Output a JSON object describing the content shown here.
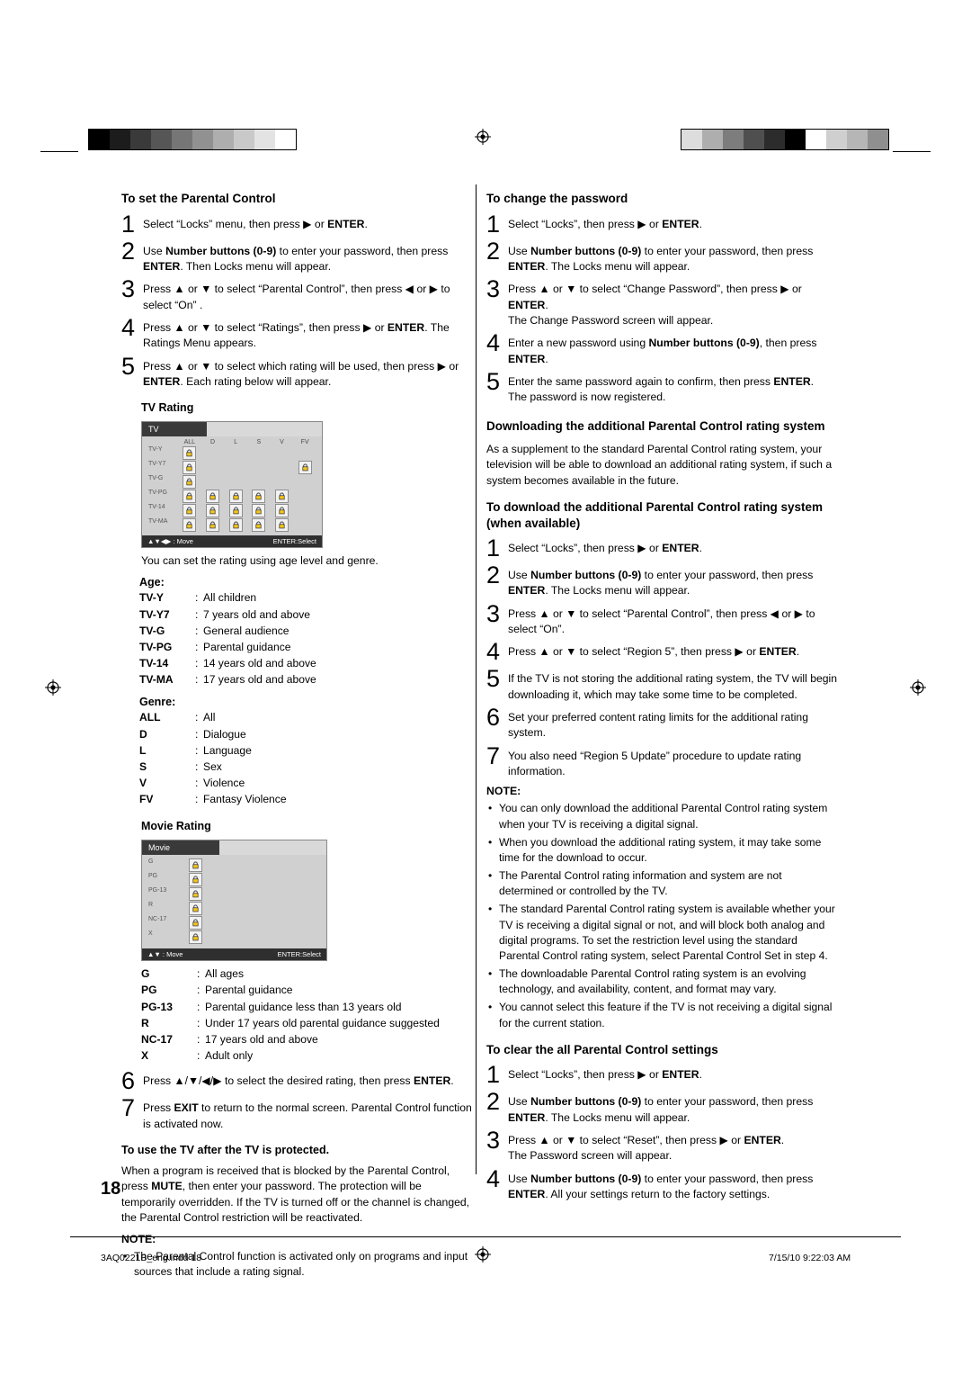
{
  "page": {
    "number": "18",
    "footer_left": "3AQ0221B_eng.indd   18",
    "footer_right": "7/15/10   9:22:03 AM"
  },
  "left": {
    "title": "To set the Parental Control",
    "steps": [
      {
        "n": "1",
        "html": "Select “Locks” menu, then press ▶ or <b>ENTER</b>."
      },
      {
        "n": "2",
        "html": "Use <b>Number buttons (0-9)</b> to enter your password, then press <b>ENTER</b>. Then Locks menu will appear."
      },
      {
        "n": "3",
        "html": "Press ▲ or ▼ to select “Parental Control”, then press ◀ or ▶ to select “On” ."
      },
      {
        "n": "4",
        "html": "Press ▲ or ▼ to select “Ratings”, then press ▶ or <b>ENTER</b>. The Ratings Menu appears."
      },
      {
        "n": "5",
        "html": "Press ▲ or ▼ to select which rating will be used, then press ▶ or <b>ENTER</b>. Each rating below will appear."
      }
    ],
    "tv_rating_label": "TV Rating",
    "tv_osd": {
      "tab": "TV",
      "columns": [
        "ALL",
        "D",
        "L",
        "S",
        "V",
        "FV"
      ],
      "rows": [
        "TV-Y",
        "TV-Y7",
        "TV-G",
        "TV-PG",
        "TV-14",
        "TV-MA"
      ],
      "locks": [
        [
          1,
          0,
          0,
          0,
          0,
          0
        ],
        [
          1,
          0,
          0,
          0,
          0,
          1
        ],
        [
          1,
          0,
          0,
          0,
          0,
          0
        ],
        [
          1,
          1,
          1,
          1,
          1,
          0
        ],
        [
          1,
          1,
          1,
          1,
          1,
          0
        ],
        [
          1,
          1,
          1,
          1,
          1,
          0
        ]
      ],
      "footer_left": "▲▼◀▶ : Move",
      "footer_right": "ENTER:Select"
    },
    "note_under_tv": "You can set the rating using age level and genre.",
    "age_label": "Age:",
    "age_items": [
      {
        "k": "TV-Y",
        "v": "All children"
      },
      {
        "k": "TV-Y7",
        "v": "7 years old and above"
      },
      {
        "k": "TV-G",
        "v": "General audience"
      },
      {
        "k": "TV-PG",
        "v": "Parental guidance"
      },
      {
        "k": "TV-14",
        "v": "14 years old and above"
      },
      {
        "k": "TV-MA",
        "v": "17 years old and above"
      }
    ],
    "genre_label": "Genre:",
    "genre_items": [
      {
        "k": "ALL",
        "v": "All"
      },
      {
        "k": "D",
        "v": "Dialogue"
      },
      {
        "k": "L",
        "v": "Language"
      },
      {
        "k": "S",
        "v": "Sex"
      },
      {
        "k": "V",
        "v": "Violence"
      },
      {
        "k": "FV",
        "v": "Fantasy Violence"
      }
    ],
    "movie_rating_label": "Movie Rating",
    "movie_osd": {
      "tab": "Movie",
      "rows": [
        "G",
        "PG",
        "PG-13",
        "R",
        "NC-17",
        "X"
      ],
      "footer_left": "▲▼ : Move",
      "footer_right": "ENTER:Select"
    },
    "movie_items": [
      {
        "k": "G",
        "v": "All ages"
      },
      {
        "k": "PG",
        "v": "Parental guidance"
      },
      {
        "k": "PG-13",
        "v": "Parental guidance less than 13 years old"
      },
      {
        "k": "R",
        "v": "Under 17 years old parental guidance suggested"
      },
      {
        "k": "NC-17",
        "v": "17 years old and above"
      },
      {
        "k": "X",
        "v": "Adult only"
      }
    ],
    "steps2": [
      {
        "n": "6",
        "html": "Press ▲/▼/◀/▶ to select the desired rating, then press <b>ENTER</b>."
      },
      {
        "n": "7",
        "html": "Press <b>EXIT</b> to return to the normal screen. Parental Control function is activated now."
      }
    ],
    "protected_title": "To use the TV after the TV is protected.",
    "protected_body": "When a program is received that is blocked by the Parental Control, press <b>MUTE</b>, then enter your password. The protection will be temporarily overridden. If the TV is turned off or the channel is changed, the Parental Control restriction will be reactivated.",
    "note_label": "NOTE:",
    "notes": [
      "The Parental Control function is activated only on programs and input sources that include a rating signal."
    ]
  },
  "right": {
    "title_password": "To change the password",
    "password_steps": [
      {
        "n": "1",
        "html": "Select “Locks”, then press ▶ or <b>ENTER</b>."
      },
      {
        "n": "2",
        "html": "Use <b>Number buttons (0-9)</b> to enter your password, then press <b>ENTER</b>. The Locks menu will appear."
      },
      {
        "n": "3",
        "html": "Press ▲ or ▼ to select “Change Password”, then press ▶ or <b>ENTER</b>.<br>The Change Password screen will appear."
      },
      {
        "n": "4",
        "html": "Enter a new password using <b>Number buttons (0-9)</b>, then press <b>ENTER</b>."
      },
      {
        "n": "5",
        "html": "Enter the same password again to confirm, then press <b>ENTER</b>.<br>The password is now registered."
      }
    ],
    "title_download": "Downloading the additional Parental Control rating system",
    "download_body": "As a supplement to the standard Parental Control rating system, your television will be able to download an additional rating system, if such a system becomes available in the future.",
    "title_download_steps": "To download the additional Parental Control rating system (when available)",
    "download_steps": [
      {
        "n": "1",
        "html": "Select “Locks”, then press ▶ or <b>ENTER</b>."
      },
      {
        "n": "2",
        "html": "Use <b>Number buttons (0-9)</b> to enter your password, then press <b>ENTER</b>. The Locks menu will appear."
      },
      {
        "n": "3",
        "html": "Press ▲ or ▼ to select “Parental Control”, then press ◀ or ▶ to select “On”."
      },
      {
        "n": "4",
        "html": "Press ▲ or ▼ to select “Region 5”, then press ▶ or <b>ENTER</b>."
      },
      {
        "n": "5",
        "html": "If the TV is not storing the additional rating system, the TV will begin downloading it, which may take some time to be completed."
      },
      {
        "n": "6",
        "html": "Set your preferred content rating limits for the additional rating system."
      },
      {
        "n": "7",
        "html": "You also need “Region 5 Update” procedure to update rating information."
      }
    ],
    "note_label": "NOTE:",
    "notes": [
      "You can only download the additional Parental Control rating system when your TV is receiving a digital signal.",
      "When you download the additional rating system, it may take some time for the download to occur.",
      "The Parental Control rating information and system are not determined or controlled by the TV.",
      "The standard Parental Control rating system is available whether your TV is receiving a digital signal or not, and will block both analog and digital programs. To set the restriction level using the standard Parental Control rating system, select Parental Control Set in step 4.",
      "The downloadable Parental Control rating system is an evolving technology, and availability, content, and format may vary.",
      "You cannot select this feature if the TV is not receiving a digital signal for the current station."
    ],
    "title_clear": "To clear the all Parental Control settings",
    "clear_steps": [
      {
        "n": "1",
        "html": "Select “Locks”, then press ▶ or <b>ENTER</b>."
      },
      {
        "n": "2",
        "html": "Use <b>Number buttons (0-9)</b> to enter your password, then press <b>ENTER</b>. The Locks menu will appear."
      },
      {
        "n": "3",
        "html": "Press ▲ or ▼ to select “Reset”, then press ▶ or <b>ENTER</b>.<br>The Password screen will appear."
      },
      {
        "n": "4",
        "html": "Use <b>Number buttons (0-9)</b> to enter your password, then press <b>ENTER</b>. All your settings return to the factory settings."
      }
    ]
  },
  "marks": {
    "left_bar": [
      "#000000",
      "#1a1a1a",
      "#333333",
      "#4d4d4d",
      "#666666",
      "#808080",
      "#999999",
      "#b3b3b3",
      "#cccccc",
      "#e6e6e6"
    ],
    "right_bar": [
      "#e0e0e0",
      "#b3b3b3",
      "#808080",
      "#4d4d4d",
      "#333333",
      "#000000",
      "#ffffff",
      "#d0d0d0",
      "#b0b0b0",
      "#8f8f8f"
    ]
  }
}
